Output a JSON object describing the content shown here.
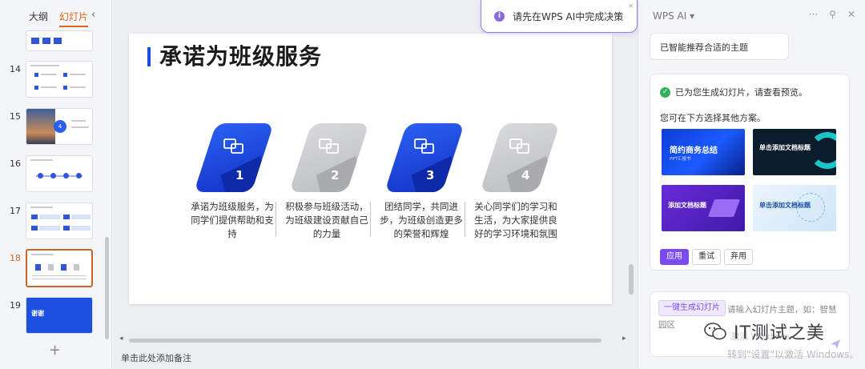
{
  "left_panel": {
    "tabs": [
      "大纲",
      "幻灯片"
    ],
    "active_tab": "幻灯片",
    "collapse_icon": "chevron-left-icon",
    "slide_numbers": [
      "14",
      "15",
      "16",
      "17",
      "18",
      "19"
    ],
    "selected_slide": "18",
    "slide_19_text": "谢谢",
    "add_icon": "plus-icon"
  },
  "slide": {
    "title": "承诺为班级服务",
    "cards": [
      {
        "num": "1",
        "text": "承诺为班级服务，为同学们提供帮助和支持",
        "style": "blue"
      },
      {
        "num": "2",
        "text": "积极参与班级活动，为班级建设贡献自己的力量",
        "style": "grey"
      },
      {
        "num": "3",
        "text": "团结同学，共同进步，为班级创造更多的荣誉和辉煌",
        "style": "blue"
      },
      {
        "num": "4",
        "text": "关心同学们的学习和生活，为大家提供良好的学习环境和氛围",
        "style": "grey"
      }
    ]
  },
  "notes_placeholder": "单击此处添加备注",
  "toast": {
    "message": "请先在WPS AI中完成决策"
  },
  "ai_panel": {
    "title": "WPS AI ▾",
    "bubble": "已智能推荐合适的主题",
    "status": "已为您生成幻灯片，请查看预览。",
    "hint": "您可在下方选择其他方案。",
    "templates": [
      {
        "title": "简约商务总结",
        "sub": "PPT汇报书"
      },
      {
        "title": "单击添加文档标题",
        "sub": ""
      },
      {
        "title": "添加文档标题",
        "sub": ""
      },
      {
        "title": "单击添加文档标题",
        "sub": ""
      }
    ],
    "buttons": {
      "apply": "应用",
      "retry": "重试",
      "discard": "弃用"
    },
    "gen_chip": "一键生成幻灯片",
    "input_placeholder": "请输入幻灯片主题，如：智慧园区"
  },
  "watermark": {
    "brand": "IT测试之美",
    "activate": "转到\"设置\"以激活 Windows。",
    "faint": "激活 Windows"
  },
  "colors": {
    "accent_blue": "#1d4de0",
    "wps_purple": "#7a4cf0",
    "selected_orange": "#c8662a"
  }
}
